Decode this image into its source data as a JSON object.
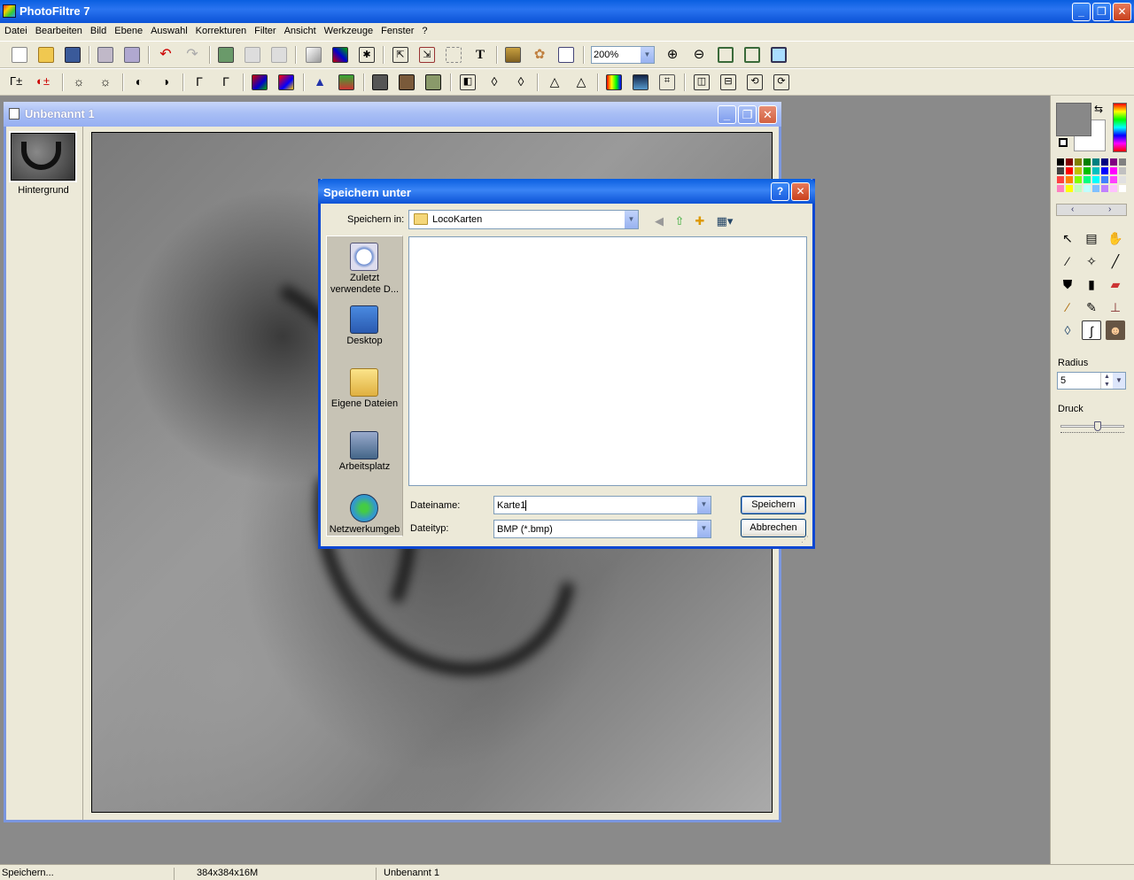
{
  "app": {
    "title": "PhotoFiltre 7"
  },
  "menu": [
    "Datei",
    "Bearbeiten",
    "Bild",
    "Ebene",
    "Auswahl",
    "Korrekturen",
    "Filter",
    "Ansicht",
    "Werkzeuge",
    "Fenster",
    "?"
  ],
  "toolbar": {
    "zoom_value": "200%"
  },
  "document": {
    "title": "Unbenannt 1",
    "layer_name": "Hintergrund"
  },
  "right_panel": {
    "radius_label": "Radius",
    "radius_value": "5",
    "druck_label": "Druck"
  },
  "colors": {
    "fg": "#888888",
    "bg": "#ffffff",
    "title_blue": "#0a5fe0",
    "palette": [
      "#000000",
      "#800000",
      "#808000",
      "#008000",
      "#008080",
      "#000080",
      "#800080",
      "#808080",
      "#404040",
      "#ff0000",
      "#c0c000",
      "#00c000",
      "#00c0c0",
      "#0000ff",
      "#ff00ff",
      "#c0c0c0",
      "#ff4040",
      "#ff8000",
      "#80ff00",
      "#00ff80",
      "#00ffff",
      "#4080ff",
      "#ff40ff",
      "#e0e0e0",
      "#ff80c0",
      "#ffff00",
      "#c0ffc0",
      "#c0ffff",
      "#80c0ff",
      "#c080ff",
      "#ffc0ff",
      "#ffffff"
    ]
  },
  "status": {
    "message": "Speichern...",
    "image_info": "384x384x16M",
    "document": "Unbenannt 1"
  },
  "dialog": {
    "title": "Speichern unter",
    "save_in_label": "Speichern in:",
    "save_in_value": "LocoKarten",
    "places": [
      {
        "label": "Zuletzt verwendete D...",
        "icon": "recent-clock-icon"
      },
      {
        "label": "Desktop",
        "icon": "desktop-icon"
      },
      {
        "label": "Eigene Dateien",
        "icon": "my-documents-icon"
      },
      {
        "label": "Arbeitsplatz",
        "icon": "my-computer-icon"
      },
      {
        "label": "Netzwerkumgeb",
        "icon": "network-icon"
      }
    ],
    "filename_label": "Dateiname:",
    "filename_value": "Karte1",
    "filetype_label": "Dateityp:",
    "filetype_value": "BMP (*.bmp)",
    "save_button": "Speichern",
    "cancel_button": "Abbrechen"
  }
}
